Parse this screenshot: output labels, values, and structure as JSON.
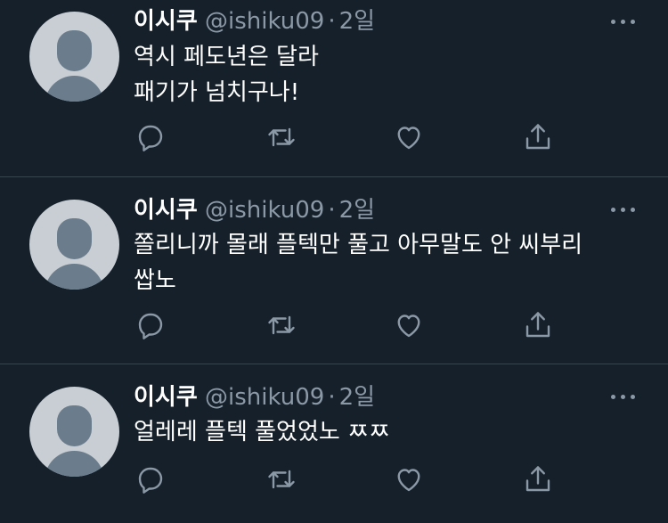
{
  "tweets": [
    {
      "name": "이시쿠",
      "handle": "@ishiku09",
      "separator": "·",
      "time": "2일",
      "lines": [
        "역시 페도년은 달라",
        "패기가 넘치구나!"
      ]
    },
    {
      "name": "이시쿠",
      "handle": "@ishiku09",
      "separator": "·",
      "time": "2일",
      "lines": [
        "쫄리니까 몰래 플텍만 풀고 아무말도 안 씨부리",
        "쌉노"
      ]
    },
    {
      "name": "이시쿠",
      "handle": "@ishiku09",
      "separator": "·",
      "time": "2일",
      "lines": [
        "얼레레 플텍 풀었었노 ㅉㅉ"
      ]
    }
  ],
  "icons": {
    "reply": "reply-icon",
    "retweet": "retweet-icon",
    "like": "like-icon",
    "share": "share-icon",
    "more": "more-icon"
  },
  "colors": {
    "background": "#15202b",
    "text": "#ffffff",
    "secondary": "#8b98a5",
    "divider": "#38444d",
    "avatar_bg": "#c8ced3",
    "avatar_fg": "#6b7d8c"
  }
}
